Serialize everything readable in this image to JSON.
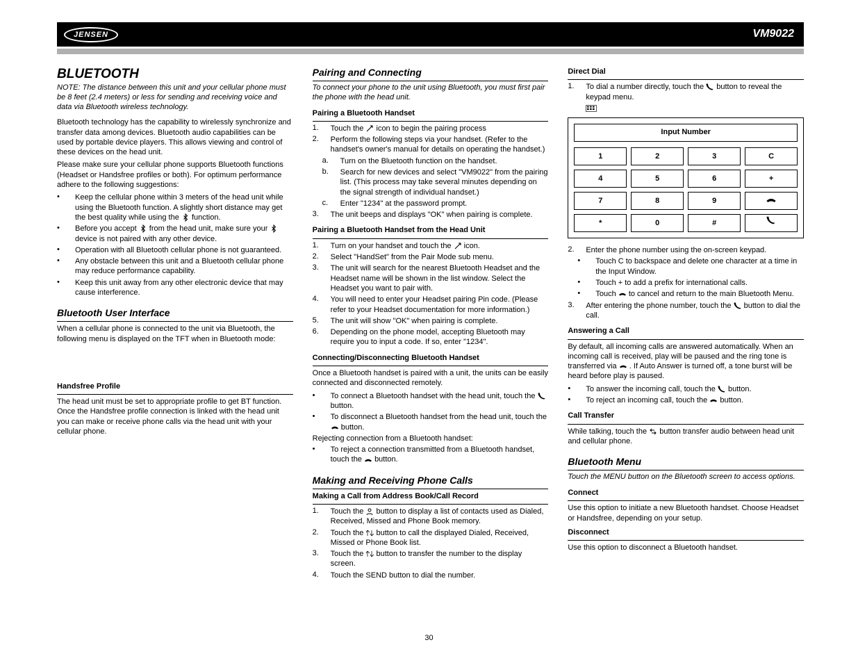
{
  "header": {
    "logo": "JENSEN",
    "model": "VM9022"
  },
  "col1": {
    "title": "BLUETOOTH",
    "sub_note": "NOTE: The distance between this unit and your cellular phone must be 8 feet (2.4 meters) or less for sending and receiving voice and data via Bluetooth wireless technology.",
    "p1": "Bluetooth technology has the capability to wirelessly synchronize and transfer data among devices. Bluetooth audio capabilities can be used by portable device players. This allows viewing and control of these devices on the head unit.",
    "p2": "Please make sure your cellular phone supports Bluetooth functions (Headset or Handsfree profiles or both). For optimum performance adhere to the following suggestions:",
    "bullet1_a": "Keep the cellular phone within 3 meters of the head unit while using the Bluetooth function. A slightly short distance may get the best quality while",
    "bullet1_b": "using the ",
    "bullet1_c": " function.",
    "bullet2_a": "Before you accept ",
    "bullet2_b": " from the head unit, make sure your",
    "bullet2_c": " device is not paired with any other device.",
    "bullet3": "Operation with all Bluetooth cellular phone is not guaranteed.",
    "bullet4": "Any obstacle between this unit and a Bluetooth cellular phone may reduce performance capability.",
    "bullet5": "Keep this unit away from any other electronic device that may cause interference.",
    "h2a": "Bluetooth User Interface",
    "p3": "When a cellular phone is connected to the unit via Bluetooth, the following menu is displayed on the TFT when in Bluetooth mode:",
    "hf_title": "Handsfree Profile",
    "hf_body": "The head unit must be set to appropriate profile to get BT function. Once the Handsfree profile connection is linked with the head unit you can make or receive phone calls via the head unit with your cellular phone."
  },
  "col2": {
    "h_pair": "Pairing and Connecting",
    "pair_sub": "To connect your phone to the unit using Bluetooth, you must first pair the phone with the head unit.",
    "ph_title": "Pairing a Bluetooth Handset",
    "ph_s1_a": "Touch the ",
    "ph_s1_b": " icon to begin the pairing process",
    "ph_s2": "Perform the following steps via your handset. (Refer to the handset's owner's manual for details on operating the handset.)",
    "ph_s2a": "Turn on the Bluetooth function on the handset.",
    "ph_s2b": "Search for new devices and select \"VM9022\" from the pairing list. (This process may take several minutes depending on the signal strength of individual handset.)",
    "ph_s2c": "Enter \"1234\" at the password prompt.",
    "ph_s3": "The unit beeps and displays \"OK\" when pairing is complete.",
    "hu_title": "Pairing a Bluetooth Handset from the Head Unit",
    "hu_s1_a": "Turn on your handset and touch the ",
    "hu_s1_b": " icon.",
    "hu_s2": "Select \"HandSet\" from the Pair Mode sub menu.",
    "hu_s3": "The unit will search for the nearest Bluetooth Headset and the Headset name will be shown in the list window. Select the Headset you want to pair with.",
    "hu_s4": "You will need to enter your Headset pairing Pin code. (Please refer to your Headset documentation for more information.)",
    "hu_s5": "The unit will show \"OK\" when pairing is complete.",
    "hu_s6": "Depending on the phone model, accepting Bluetooth may require you to input a code. If so, enter \"1234\".",
    "cd_title": "Connecting/Disconnecting Bluetooth Handset",
    "cd_p1": "Once a Bluetooth handset is paired with a unit, the units can be easily connected and disconnected remotely.",
    "cd_b1_a": "To connect a Bluetooth handset with the head unit, touch the ",
    "cd_b1_b": " button.",
    "cd_b2_a": "To disconnect a Bluetooth handset from the head unit, touch the ",
    "cd_b2_b": " button.",
    "cd_rej": "Rejecting connection from a Bluetooth handset:",
    "cd_b3_a": "To reject a connection transmitted from a Bluetooth handset, touch the ",
    "cd_b3_b": " button.",
    "h_calls": "Making and Receiving Phone Calls",
    "mc_title": "Making a Call from Address Book/Call Record",
    "mc_s1_a": "Touch the ",
    "mc_s1_b": " button to display a list of contacts used as Dialed, Received, Missed and Phone Book memory.",
    "mc_s2_a": "Touch the ",
    "mc_s2_b": " button to call the displayed Dialed, Received, Missed or Phone Book list.",
    "mc_s3_a": "Touch the ",
    "mc_s3_b": " button to transfer the number to the display screen.",
    "mc_s4": "Touch the SEND button to dial the number."
  },
  "col3": {
    "dd_title": "Direct Dial",
    "dd_s1_a": "To dial a number directly, touch the ",
    "dd_s1_b": " button to reveal the keypad menu.",
    "kp_display": "Input Number",
    "keys": [
      "1",
      "2",
      "3",
      "C",
      "4",
      "5",
      "6",
      "+",
      "7",
      "8",
      "9",
      "",
      "*",
      "0",
      "#",
      ""
    ],
    "kp_s2": "Enter the phone number using the on-screen keypad.",
    "kp_s2a": "Touch C to backspace and delete one character at a time in the Input Window.",
    "kp_s2b": "Touch + to add a prefix for international calls.",
    "kp_s2c_a": "Touch ",
    "kp_s2c_b": " to cancel and return to the main Bluetooth Menu.",
    "kp_s3_a": "After entering the phone number, touch the ",
    "kp_s3_b": " button to dial the call.",
    "ac_title": "Answering a Call",
    "ac_p1_a": "By default, all incoming calls are answered automatically. When an incoming call is received, play will be paused and the ring tone is transferred via ",
    "ac_p1_b": ". If Auto Answer is turned off, a tone burst will be heard before play is paused.",
    "ac_b1_a": "To answer the incoming call, touch the ",
    "ac_b1_b": " button.",
    "ac_b2_a": "To reject an incoming call, touch the ",
    "ac_b2_b": " button.",
    "ct_title": "Call Transfer",
    "ct_p_a": "While talking, touch the ",
    "ct_p_b": " button transfer audio between head unit and cellular phone.",
    "h_menu": "Bluetooth Menu",
    "menu_sub": "Touch the MENU button on the Bluetooth screen to access options.",
    "con_title": "Connect",
    "con_body": "Use this option to initiate a new Bluetooth handset. Choose Headset or Handsfree, depending on your setup.",
    "dis_title": "Disconnect",
    "dis_body": "Use this option to disconnect a Bluetooth handset."
  },
  "page": "30"
}
